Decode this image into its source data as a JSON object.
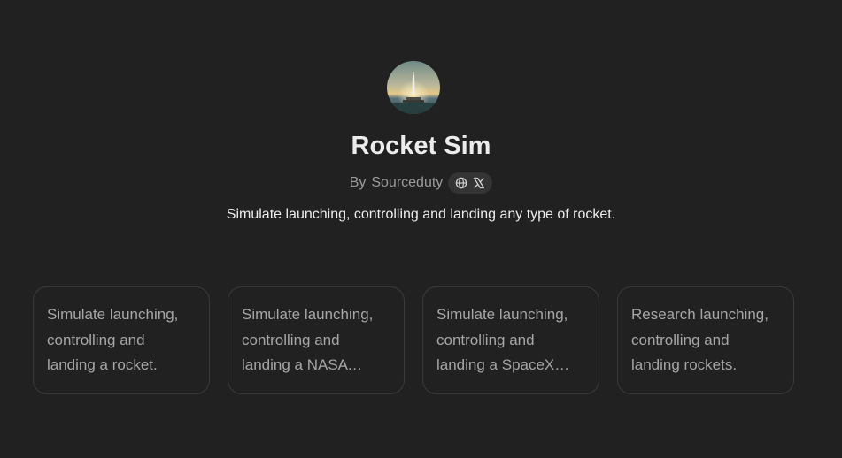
{
  "gpt": {
    "title": "Rocket Sim",
    "author_prefix": "By",
    "author": "Sourceduty",
    "description": "Simulate launching, controlling and landing any type of rocket.",
    "links": [
      {
        "icon": "globe-icon"
      },
      {
        "icon": "x-logo-icon"
      }
    ]
  },
  "starters": [
    {
      "text": "Simulate launching, controlling and landing a rocket."
    },
    {
      "text": "Simulate launching, controlling and landing a NASA rocket."
    },
    {
      "text": "Simulate launching, controlling and landing a SpaceX rocket."
    },
    {
      "text": "Research launching, controlling and landing rockets."
    }
  ],
  "colors": {
    "background": "#212121",
    "title": "#ececec",
    "muted": "#9b9b9b",
    "card_border": "#3a3a3a",
    "card_text": "#a6a6a6"
  }
}
